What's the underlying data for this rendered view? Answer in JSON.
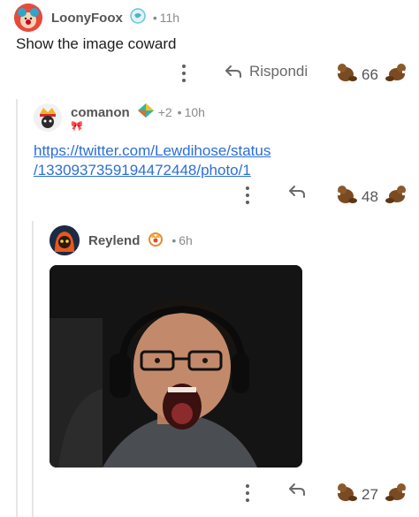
{
  "comments": [
    {
      "username": "LoonyFoox",
      "time": "11h",
      "body": "Show the image coward",
      "reply_label": "Rispondi",
      "votes": "66"
    },
    {
      "username": "comanon",
      "awards": "+2",
      "time": "10h",
      "flair_text": "🎀",
      "link_line1": "https://twitter.com/Lewdihose/status",
      "link_line2": "/1330937359194472448/photo/1",
      "votes": "48"
    },
    {
      "username": "Reylend",
      "time": "6h",
      "votes": "27"
    }
  ],
  "icons": {
    "reply": "reply-arrow-icon",
    "more": "kebab-menu-icon",
    "upvote": "beaver-upvote-icon",
    "downvote": "beaver-downvote-icon"
  },
  "colors": {
    "link": "#2b6fd6",
    "thread_line": "#e6e6e6",
    "meta": "#8a8a8a"
  }
}
